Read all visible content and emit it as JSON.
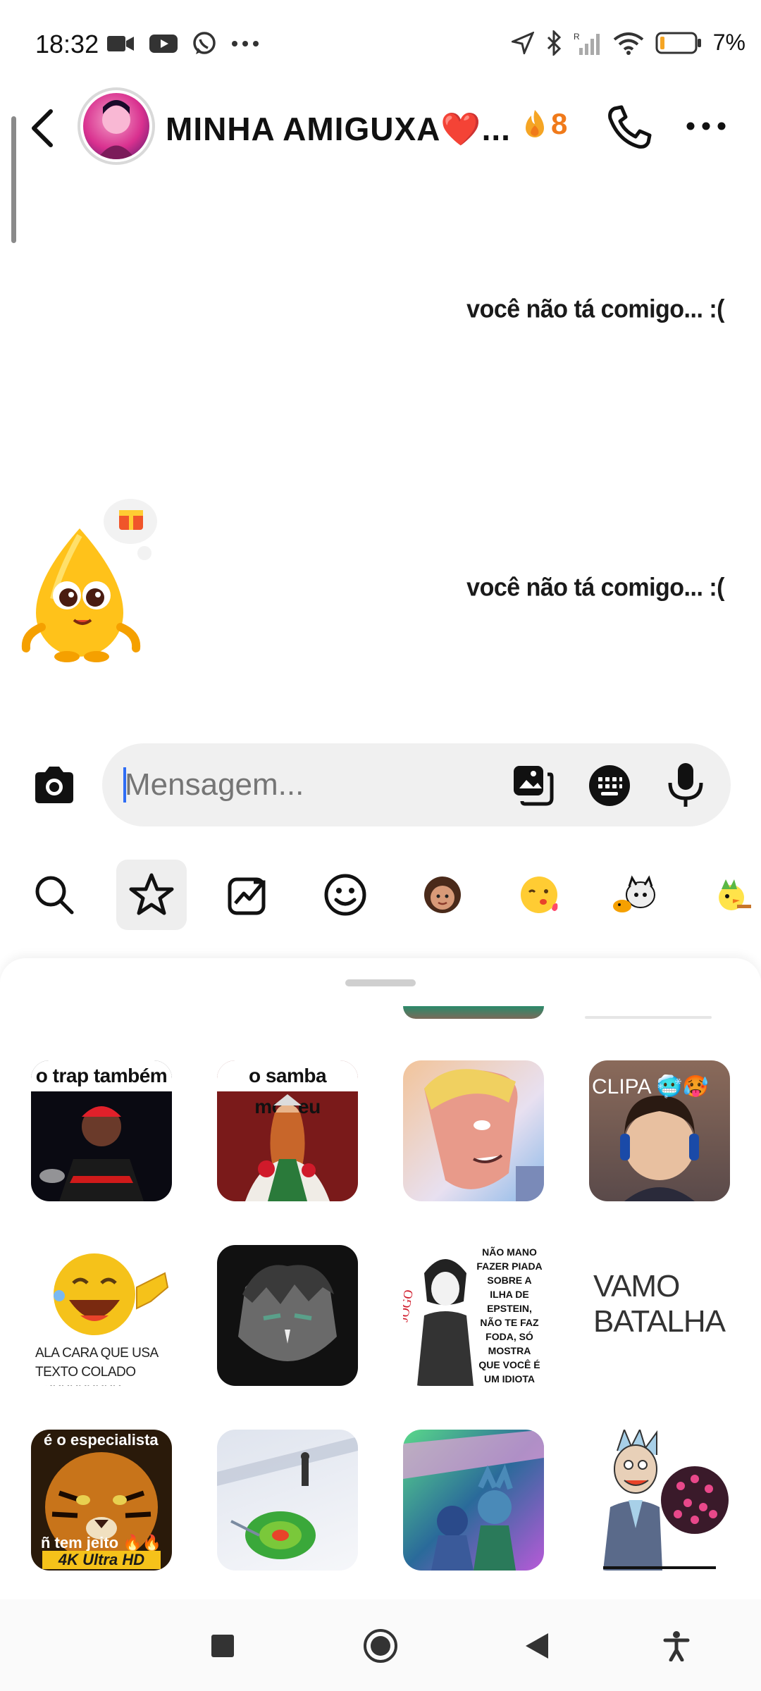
{
  "status_bar": {
    "time": "18:32",
    "battery": "7%",
    "icons": [
      "video-camera-icon",
      "youtube-icon",
      "whatsapp-icon",
      "more-dots-icon",
      "location-icon",
      "bluetooth-icon",
      "signal-icon",
      "wifi-icon",
      "battery-icon"
    ]
  },
  "header": {
    "title": "MINHA AMIGUXA❤️...",
    "streak_count": "8",
    "streak_icon": "fire-icon",
    "colors": {
      "streak": "#f07a1a"
    }
  },
  "messages": [
    {
      "text": "você não tá comigo... :("
    },
    {
      "text": "você não tá comigo... :("
    }
  ],
  "composer": {
    "placeholder": "Mensagem...",
    "caret_color": "#2f6df5"
  },
  "sticker_tabs": [
    "search-icon",
    "favorites-star-icon",
    "trending-icon",
    "emoji-icon",
    "avatar-sticker",
    "kiss-emoji-sticker",
    "mascot-sticker",
    "bird-sticker"
  ],
  "sticker_grid": {
    "captions": {
      "trap": "o trap também",
      "samba": "o samba morreu",
      "clipa": "CLIPA 🥶🥵",
      "laugh": "ALA CARA QUE USA TEXTO COLADO KKKKKKKKKK",
      "manga_text": "NÃO MANO FAZER PIADA SOBRE A ILHA DE EPSTEIN, NÃO TE FAZ FODA, SÓ MOSTRA QUE VOCÊ É UM IDIOTA",
      "vamo": "VAMO BATALHA",
      "tiger_top": "é o especialista",
      "tiger_mid": "ñ tem jeito 🔥🔥",
      "tiger_bottom": "4K Ultra HD"
    }
  },
  "nav_bar": [
    "recents-square-icon",
    "home-circle-icon",
    "back-triangle-icon",
    "accessibility-icon"
  ]
}
